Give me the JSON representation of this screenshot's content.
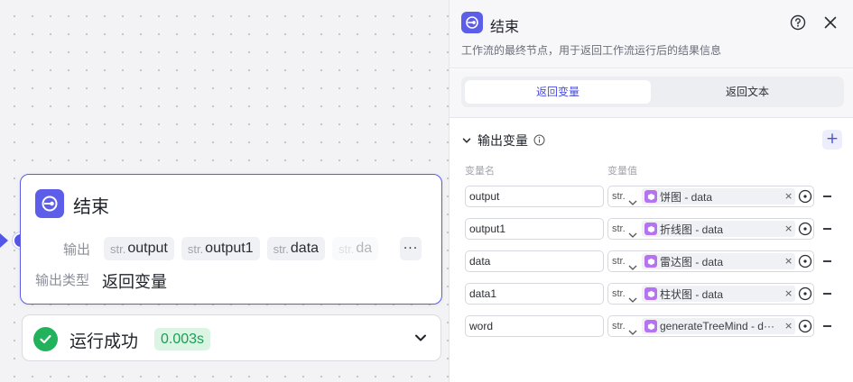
{
  "node": {
    "title": "结束",
    "output_label": "输出",
    "outputs": [
      {
        "type": "str.",
        "name": "output"
      },
      {
        "type": "str.",
        "name": "output1"
      },
      {
        "type": "str.",
        "name": "data"
      },
      {
        "type": "str.",
        "name": "da"
      }
    ],
    "more_label": "···",
    "output_type_label": "输出类型",
    "output_type_value": "返回变量"
  },
  "run": {
    "status": "运行成功",
    "duration": "0.003s"
  },
  "panel": {
    "title": "结束",
    "description": "工作流的最终节点，用于返回工作流运行后的结果信息",
    "tabs": [
      "返回变量",
      "返回文本"
    ],
    "section_title": "输出变量",
    "add_label": "+",
    "col_name": "变量名",
    "col_value": "变量值",
    "variables": [
      {
        "name": "output",
        "type": "str.",
        "ref": "饼图 - data"
      },
      {
        "name": "output1",
        "type": "str.",
        "ref": "折线图 - data"
      },
      {
        "name": "data",
        "type": "str.",
        "ref": "雷达图 - data"
      },
      {
        "name": "data1",
        "type": "str.",
        "ref": "柱状图 - data"
      },
      {
        "name": "word",
        "type": "str.",
        "ref": "generateTreeMind - d···"
      }
    ],
    "clear_label": "×"
  },
  "colors": {
    "accent": "#5c5ee9",
    "success": "#22b25c",
    "ref_icon": "#b673ef"
  }
}
